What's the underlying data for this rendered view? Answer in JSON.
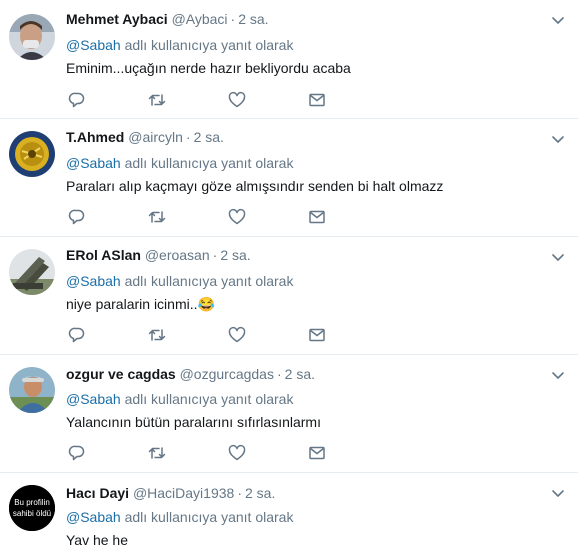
{
  "reply_prefix": "adlı kullanıcıya yanıt olarak",
  "tweets": [
    {
      "name": "Mehmet Aybaci",
      "handle": "@Aybaci",
      "time": "2 sa.",
      "reply_mention": "@Sabah",
      "text": "Eminim...uçağın nerde hazır bekliyordu acaba"
    },
    {
      "name": "T.Ahmed",
      "handle": "@aircyln",
      "time": "2 sa.",
      "reply_mention": "@Sabah",
      "text": "Paraları alıp kaçmayı göze almışsındır senden bi halt olmazz"
    },
    {
      "name": "ERol ASlan",
      "handle": "@eroasan",
      "time": "2 sa.",
      "reply_mention": "@Sabah",
      "text": "niye paralarin icinmi.."
    },
    {
      "name": "ozgur ve cagdas",
      "handle": "@ozgurcagdas",
      "time": "2 sa.",
      "reply_mention": "@Sabah",
      "text": "Yalancının bütün paralarını sıfırlasınlarmı"
    },
    {
      "name": "Hacı Dayi",
      "handle": "@HaciDayi1938",
      "time": "2 sa.",
      "reply_mention": "@Sabah",
      "text": "Yav he he",
      "avatar_text": "Bu profilin sahibi öldü"
    }
  ],
  "colors": {
    "link": "#1b6fa8",
    "muted": "#657786",
    "divider": "#e6ecf0",
    "action_icon": "#657786"
  },
  "icons": {
    "reply": "reply-icon",
    "retweet": "retweet-icon",
    "like": "heart-icon",
    "dm": "envelope-icon",
    "more": "chevron-down-icon"
  }
}
